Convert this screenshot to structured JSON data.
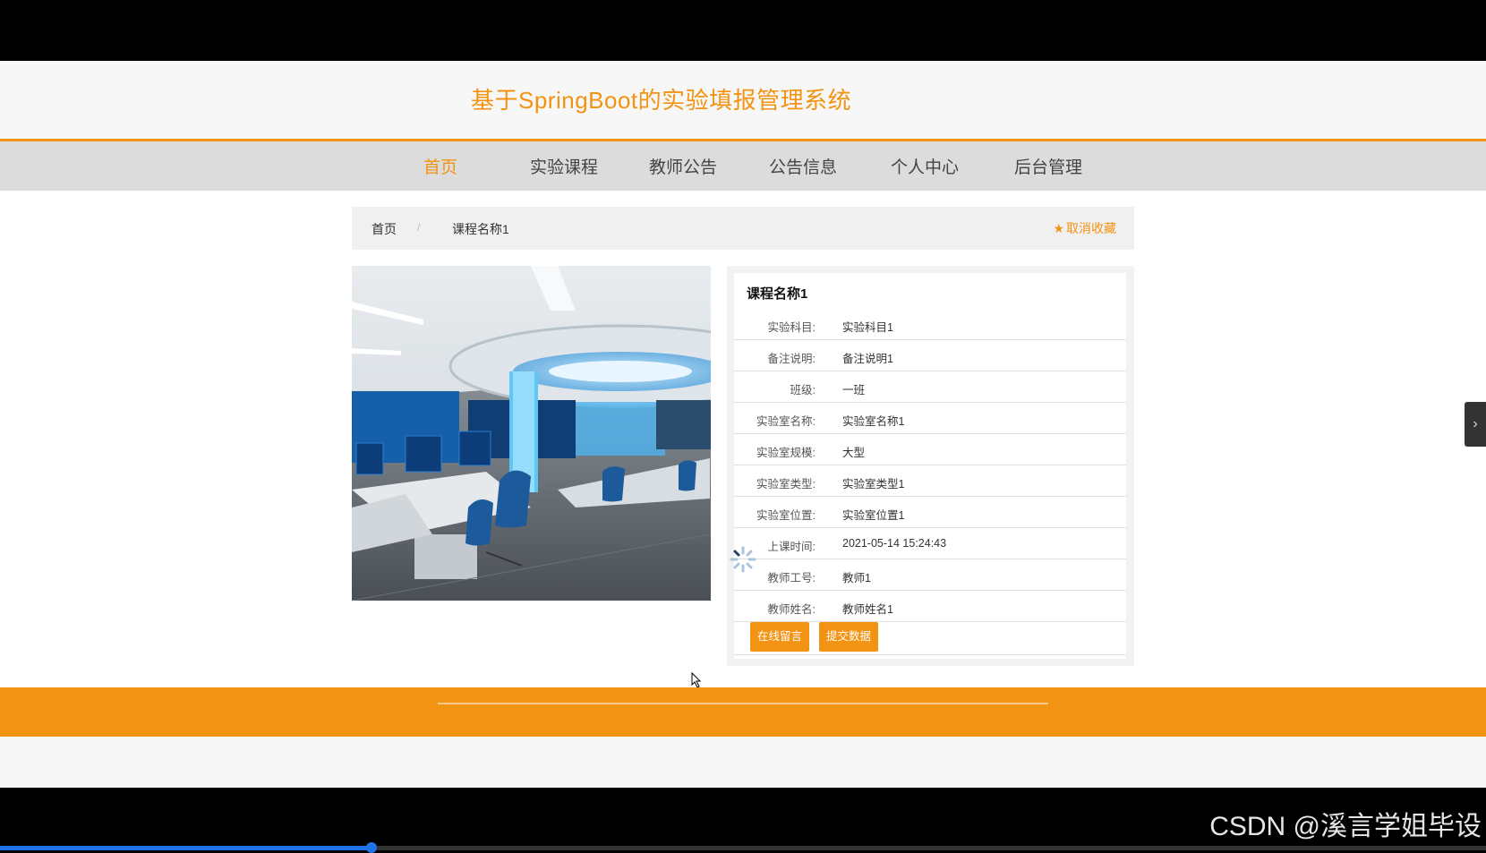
{
  "site": {
    "title": "基于SpringBoot的实验填报管理系统"
  },
  "nav": {
    "items": [
      {
        "label": "首页",
        "active": true
      },
      {
        "label": "实验课程",
        "active": false
      },
      {
        "label": "教师公告",
        "active": false
      },
      {
        "label": "公告信息",
        "active": false
      },
      {
        "label": "个人中心",
        "active": false
      },
      {
        "label": "后台管理",
        "active": false
      }
    ]
  },
  "breadcrumb": {
    "home": "首页",
    "separator": "/",
    "current": "课程名称1"
  },
  "favorite": {
    "label": "取消收藏",
    "icon": "star-icon"
  },
  "course": {
    "title": "课程名称1",
    "fields": [
      {
        "label": "实验科目:",
        "value": "实验科目1"
      },
      {
        "label": "备注说明:",
        "value": "备注说明1"
      },
      {
        "label": "班级:",
        "value": "一班"
      },
      {
        "label": "实验室名称:",
        "value": "实验室名称1"
      },
      {
        "label": "实验室规模:",
        "value": "大型"
      },
      {
        "label": "实验室类型:",
        "value": "实验室类型1"
      },
      {
        "label": "实验室位置:",
        "value": "实验室位置1"
      },
      {
        "label": "上课时间:",
        "value": "2021-05-14 15:24:43"
      },
      {
        "label": "教师工号:",
        "value": "教师1"
      },
      {
        "label": "教师姓名:",
        "value": "教师姓名1"
      }
    ],
    "actions": {
      "message": "在线留言",
      "submit": "提交数据"
    }
  },
  "watermark": "CSDN @溪言学姐毕设",
  "colors": {
    "accent": "#f39313",
    "nav_bg": "#dcdcdc",
    "footer": "#f39313",
    "progress": "#1e74e8"
  },
  "video_progress": 0.25
}
